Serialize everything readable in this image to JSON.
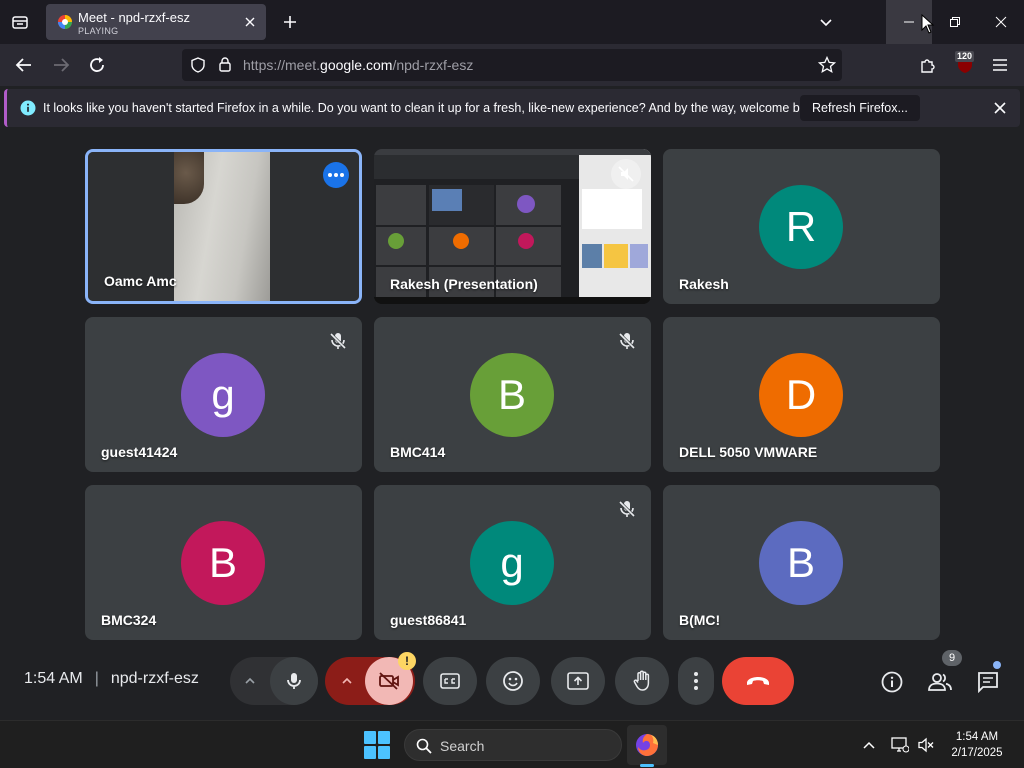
{
  "browser": {
    "tab": {
      "title": "Meet - npd-rzxf-esz",
      "status": "PLAYING"
    },
    "url": {
      "prefix": "https://meet.",
      "domain": "google.com",
      "path": "/npd-rzxf-esz"
    },
    "extension_badge": "120",
    "notification": {
      "text": "It looks like you haven't started Firefox in a while. Do you want to clean it up for a fresh, like-new experience? And by the way, welcome back!",
      "button": "Refresh Firefox..."
    }
  },
  "meet": {
    "tiles": [
      {
        "name": "Oamc Amc",
        "type": "camera",
        "active": true
      },
      {
        "name": "Rakesh (Presentation)",
        "type": "presentation"
      },
      {
        "name": "Rakesh",
        "initial": "R",
        "color": "#00897b"
      },
      {
        "name": "guest41424",
        "initial": "g",
        "color": "#7e57c2",
        "muted": true
      },
      {
        "name": "BMC414",
        "initial": "B",
        "color": "#689f38",
        "muted": true
      },
      {
        "name": "DELL 5050 VMWARE",
        "initial": "D",
        "color": "#ef6c00"
      },
      {
        "name": "BMC324",
        "initial": "B",
        "color": "#c2185b"
      },
      {
        "name": "guest86841",
        "initial": "g",
        "color": "#00897b",
        "muted": true
      },
      {
        "name": "B(MC!",
        "initial": "B",
        "color": "#5c6bc0"
      }
    ],
    "controls": {
      "time": "1:54 AM",
      "meeting_code": "npd-rzxf-esz",
      "camera_warning": "!",
      "people_count": "9"
    }
  },
  "taskbar": {
    "search_label": "Search",
    "clock_time": "1:54 AM",
    "clock_date": "2/17/2025"
  }
}
